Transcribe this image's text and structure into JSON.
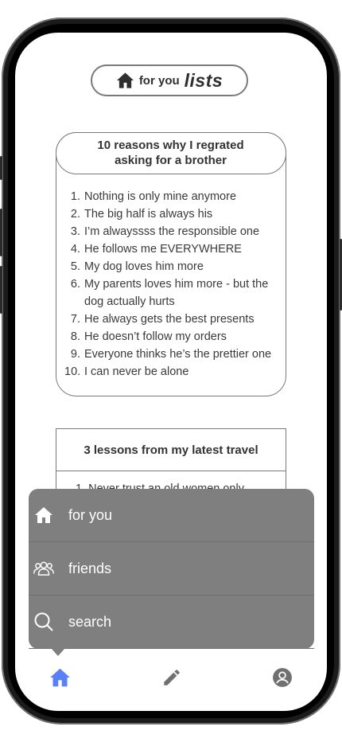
{
  "header": {
    "prefix": "for you",
    "title": "lists"
  },
  "cards": [
    {
      "title": "10 reasons why I regrated asking for a brother",
      "items": [
        {
          "num": "1.",
          "text": "Nothing is only mine anymore"
        },
        {
          "num": "2.",
          "text": "The big half is always his"
        },
        {
          "num": "3.",
          "text": "I’m alwayssss the responsible one"
        },
        {
          "num": "4.",
          "text": "He follows me EVERYWHERE"
        },
        {
          "num": "5.",
          "text": "My dog loves him more"
        },
        {
          "num": "6.",
          "text": "My parents loves him more - but the dog actually hurts"
        },
        {
          "num": "7.",
          "text": "He always gets the best presents"
        },
        {
          "num": "8.",
          "text": "He doesn’t follow my orders"
        },
        {
          "num": "9.",
          "text": "Everyone thinks he’s the prettier one"
        },
        {
          "num": "10.",
          "text": "I can never be alone"
        }
      ]
    },
    {
      "title": "3 lessons from my latest travel",
      "first_item": "1. Never trust an old women only"
    }
  ],
  "menu": {
    "items": [
      {
        "label": "for you",
        "icon": "home-icon"
      },
      {
        "label": "friends",
        "icon": "friends-icon"
      },
      {
        "label": "search",
        "icon": "search-icon"
      }
    ]
  },
  "tabbar": {
    "items": [
      {
        "icon": "home-icon",
        "active": true
      },
      {
        "icon": "pencil-icon",
        "active": false
      },
      {
        "icon": "profile-icon",
        "active": false
      }
    ],
    "active_color": "#5b7ff6",
    "inactive_color": "#707070"
  }
}
